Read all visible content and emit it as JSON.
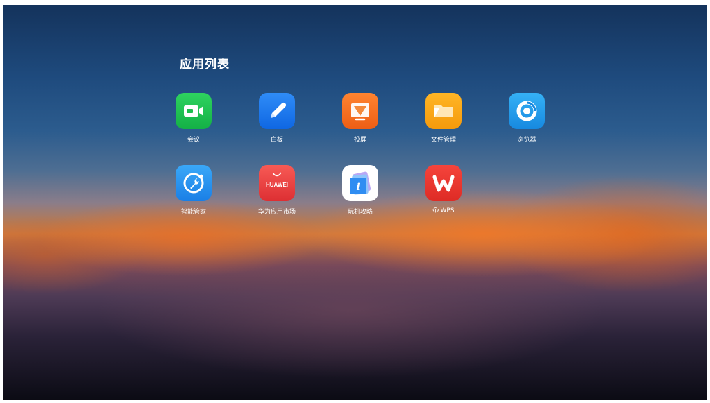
{
  "page": {
    "title": "应用列表"
  },
  "apps": [
    {
      "label": "会议",
      "icon": "video-meeting-icon",
      "color": "#1fbe4e"
    },
    {
      "label": "白板",
      "icon": "pen-whiteboard-icon",
      "color": "#1677f0"
    },
    {
      "label": "投屏",
      "icon": "screen-cast-icon",
      "color": "#f26d1e"
    },
    {
      "label": "文件管理",
      "icon": "folder-icon",
      "color": "#f5a012"
    },
    {
      "label": "浏览器",
      "icon": "browser-swirl-icon",
      "color": "#1e9be8"
    },
    {
      "label": "智能管家",
      "icon": "wrench-manager-icon",
      "color": "#2196f3"
    },
    {
      "label": "华为应用市场",
      "icon": "huawei-appgallery-icon",
      "color": "#e9403f",
      "logo_text": "HUAWEI"
    },
    {
      "label": "玩机攻略",
      "icon": "tips-info-icon",
      "color": "#ffffff",
      "logo_text": "i"
    },
    {
      "label": "WPS",
      "icon": "wps-icon",
      "color": "#e8342d",
      "status_icon": "cloud-download-icon"
    }
  ]
}
